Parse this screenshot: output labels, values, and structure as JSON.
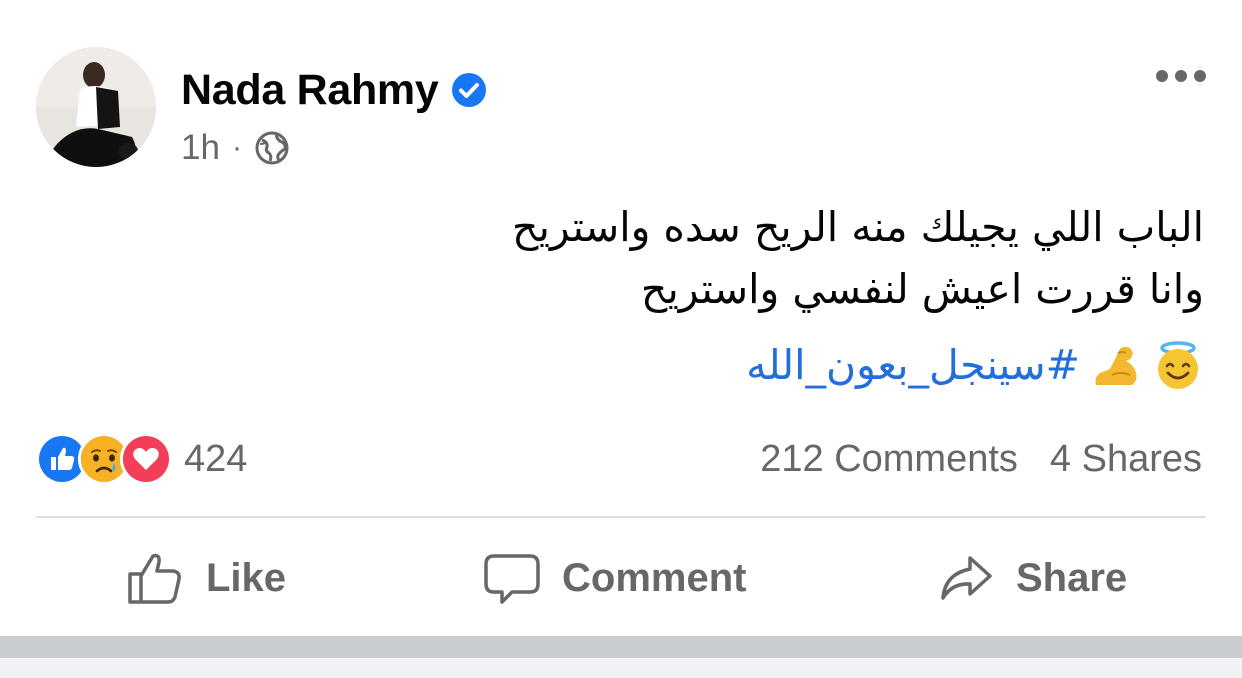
{
  "post": {
    "author_name": "Nada Rahmy",
    "verified": true,
    "timestamp": "1h",
    "separator": "·",
    "audience_icon": "globe-icon",
    "more_icon": "more-options-icon",
    "text_line_1": "الباب اللي يجيلك منه الريح سده واستريح",
    "text_line_2": "وانا قررت اعيش لنفسي واستريح",
    "hashtag": "#سينجل_بعون_الله",
    "emojis": [
      "flexed-biceps-icon",
      "smiling-face-with-halo-icon"
    ]
  },
  "reactions": {
    "icons": [
      "like-reaction-icon",
      "sad-reaction-icon",
      "love-reaction-icon"
    ],
    "count": "424"
  },
  "stats": {
    "comments": "212 Comments",
    "shares": "4 Shares"
  },
  "actions": {
    "like_label": "Like",
    "comment_label": "Comment",
    "share_label": "Share"
  },
  "colors": {
    "link_blue": "#216fdb",
    "verified_blue": "#1877f2",
    "secondary_text": "#65676b",
    "love_red": "#f33e58",
    "sad_yellow": "#f7b125"
  }
}
